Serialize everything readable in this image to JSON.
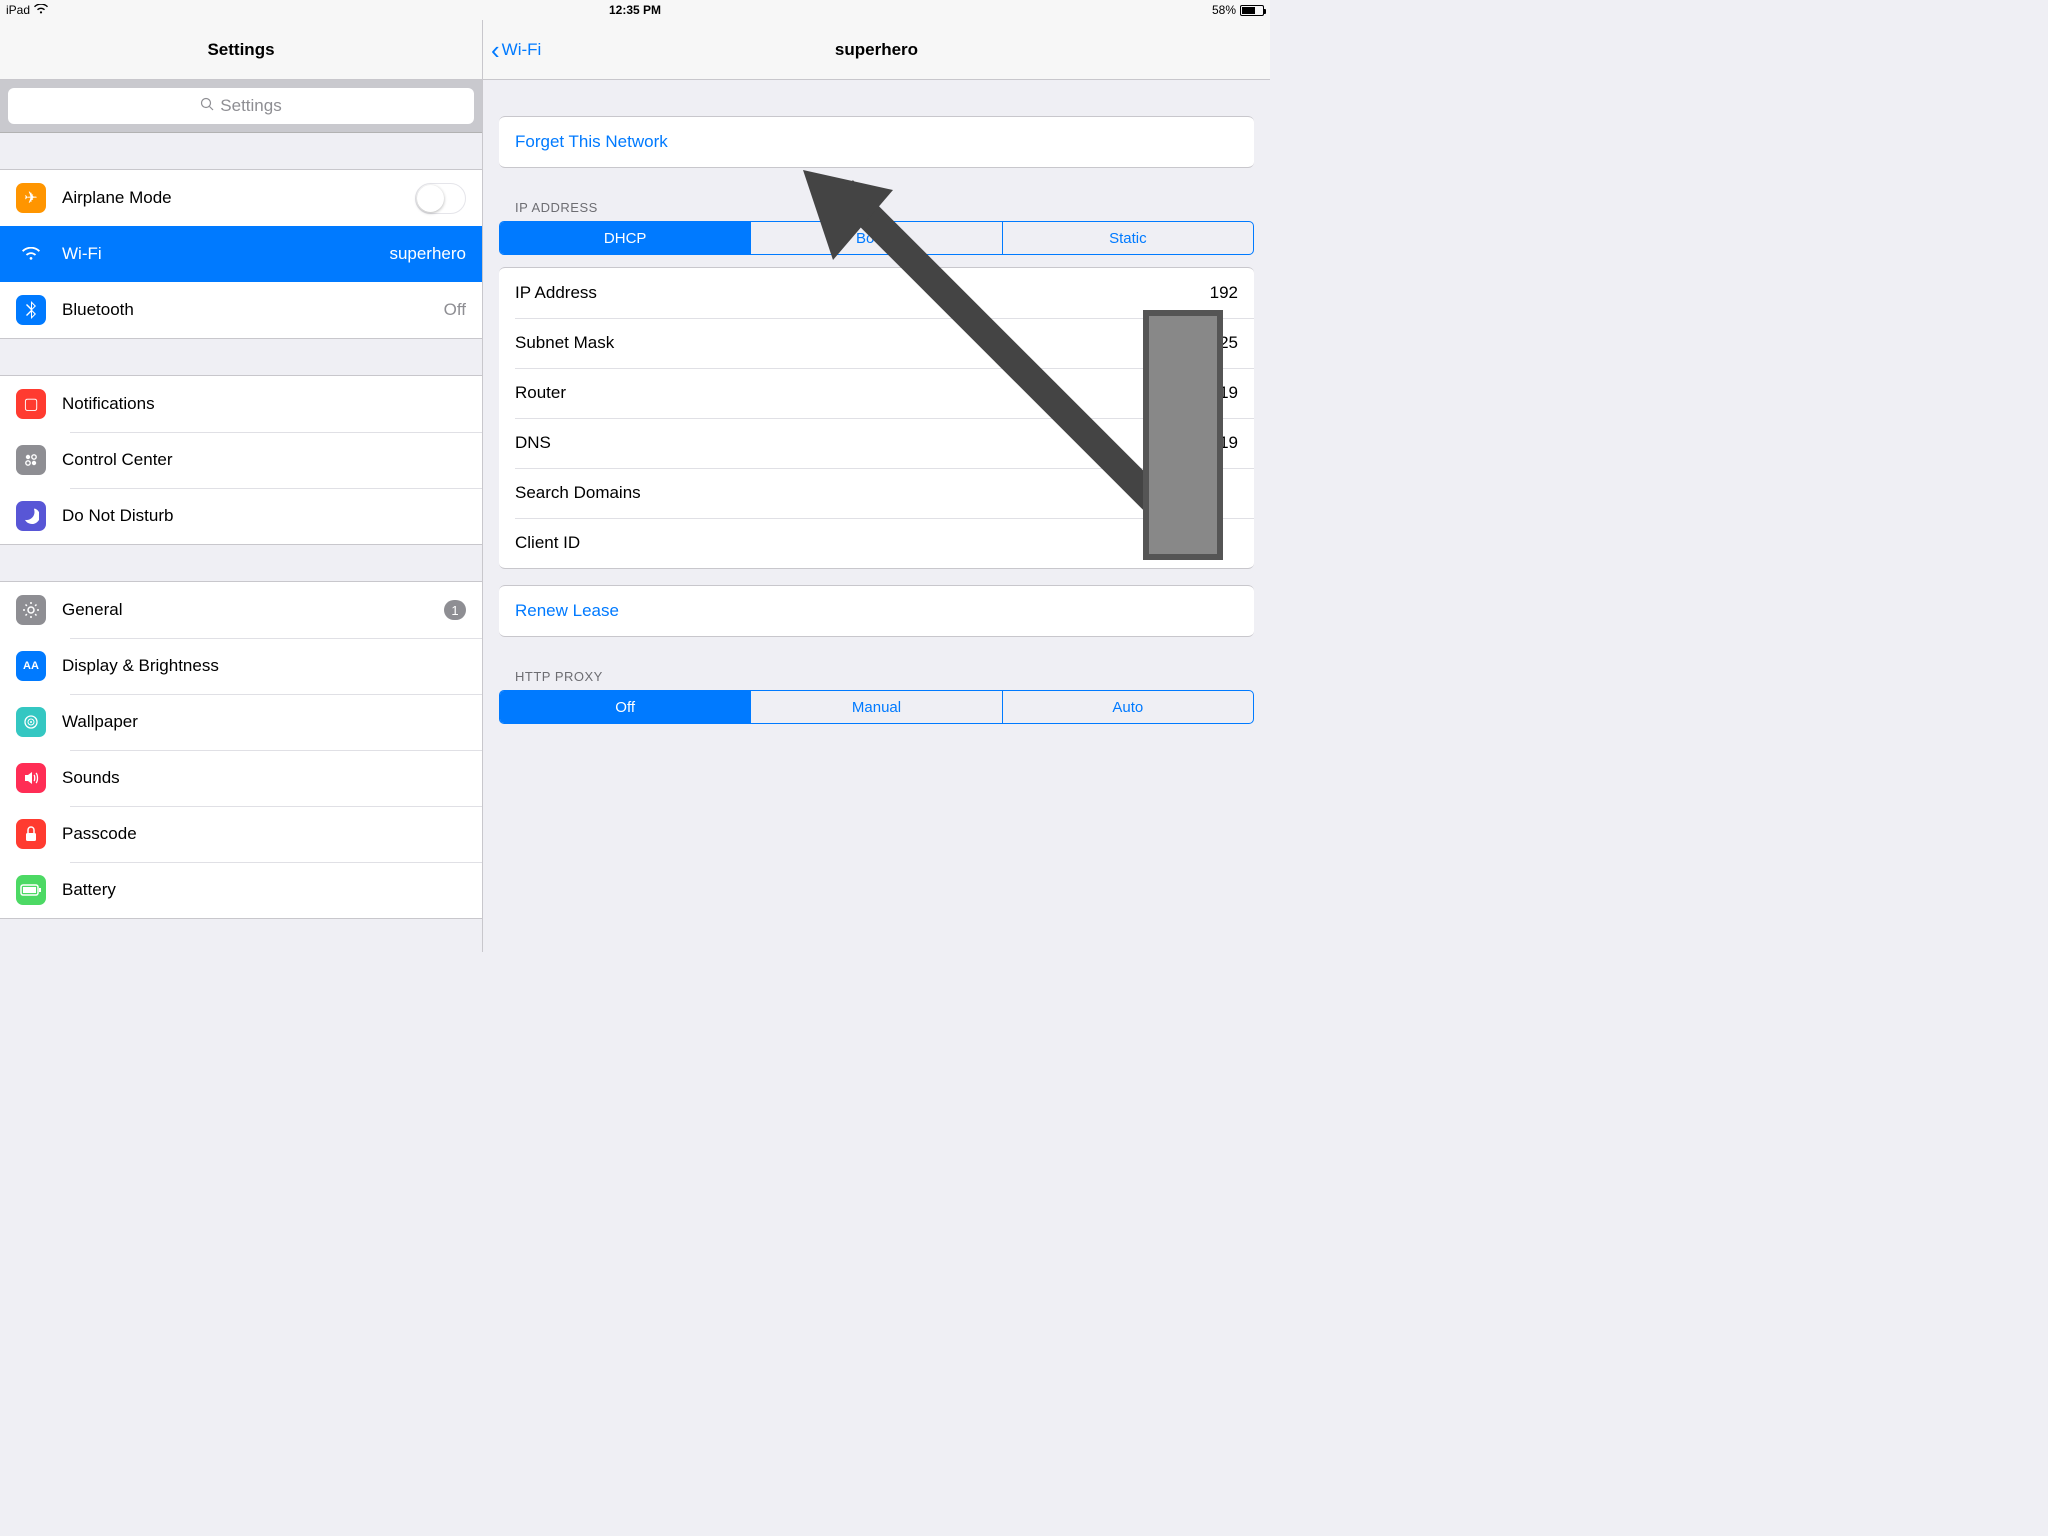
{
  "statusbar": {
    "device": "iPad",
    "time": "12:35 PM",
    "battery_pct": "58%"
  },
  "sidebar": {
    "title": "Settings",
    "search_placeholder": "Settings",
    "group1": {
      "airplane": "Airplane Mode",
      "wifi": "Wi-Fi",
      "wifi_value": "superhero",
      "bluetooth": "Bluetooth",
      "bluetooth_value": "Off"
    },
    "group2": {
      "notifications": "Notifications",
      "controlcenter": "Control Center",
      "dnd": "Do Not Disturb"
    },
    "group3": {
      "general": "General",
      "general_badge": "1",
      "display": "Display & Brightness",
      "wallpaper": "Wallpaper",
      "sounds": "Sounds",
      "passcode": "Passcode",
      "battery": "Battery"
    }
  },
  "detail": {
    "back_label": "Wi-Fi",
    "title": "superhero",
    "forget": "Forget This Network",
    "ip_section": "IP ADDRESS",
    "tabs": {
      "dhcp": "DHCP",
      "bootp": "BootP",
      "static": "Static"
    },
    "fields": {
      "ip_label": "IP Address",
      "ip_value": "192",
      "subnet_label": "Subnet Mask",
      "subnet_value": "255.25",
      "router_label": "Router",
      "router_value": "19",
      "dns_label": "DNS",
      "dns_value": "19",
      "search_label": "Search Domains",
      "search_value": "",
      "client_label": "Client ID",
      "client_value": ""
    },
    "renew": "Renew Lease",
    "proxy_section": "HTTP PROXY",
    "proxy_tabs": {
      "off": "Off",
      "manual": "Manual",
      "auto": "Auto"
    }
  }
}
